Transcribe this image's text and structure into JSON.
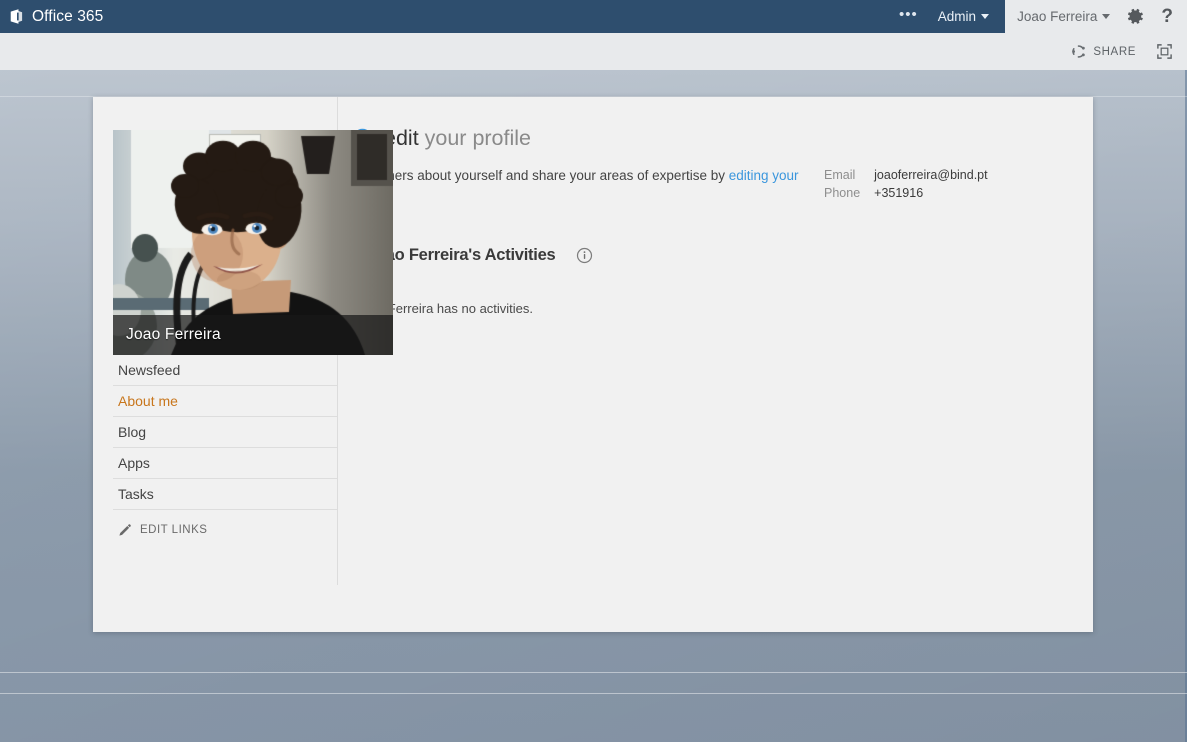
{
  "suitebar": {
    "brand": "Office 365",
    "brand_icon": "office-logo-icon",
    "ellipsis": "•••",
    "admin_label": "Admin",
    "user_name": "Joao Ferreira",
    "settings_icon": "gear-icon",
    "help_icon": "help-icon",
    "help_glyph": "?",
    "background_color": "#2e4e6e",
    "right_background_color": "#e8eaec"
  },
  "commandbar": {
    "share_label": "SHARE",
    "share_icon": "share-icon",
    "focus_icon": "focus-on-content-icon"
  },
  "profile": {
    "photo_caption": "Joao Ferreira",
    "photo_alt": "profile-photo"
  },
  "nav": {
    "items": [
      {
        "label": "Newsfeed",
        "active": false
      },
      {
        "label": "About me",
        "active": true
      },
      {
        "label": "Blog",
        "active": false
      },
      {
        "label": "Apps",
        "active": false
      },
      {
        "label": "Tasks",
        "active": false
      }
    ],
    "edit_links_label": "EDIT LINKS",
    "edit_links_icon": "pencil-icon",
    "active_color": "#c8761c"
  },
  "main": {
    "edit_icon": "edit-profile-circle-icon",
    "heading_strong": "edit",
    "heading_rest": " your profile",
    "blurb_prefix": "Tell others about yourself and share your areas of expertise by ",
    "blurb_link": "editing your profile",
    "blurb_suffix": ".",
    "link_color": "#3a96dd",
    "contact": [
      {
        "label": "Email",
        "value": "joaoferreira@bind.pt"
      },
      {
        "label": "Phone",
        "value": "+351916"
      }
    ],
    "activities_title": "Joao Ferreira's Activities",
    "activities_info_icon": "info-icon",
    "activities_empty": "Joao Ferreira has no activities."
  }
}
